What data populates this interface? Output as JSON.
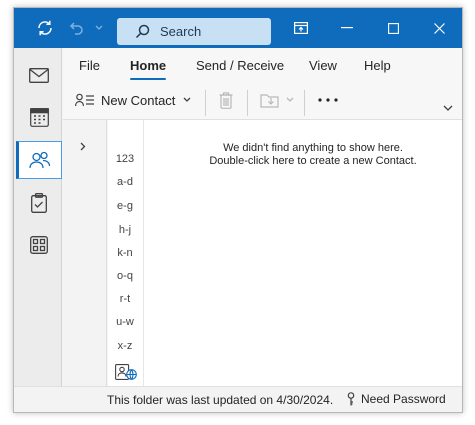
{
  "titlebar": {
    "search_placeholder": "Search"
  },
  "ribbon": {
    "tabs": [
      {
        "label": "File"
      },
      {
        "label": "Home"
      },
      {
        "label": "Send / Receive"
      },
      {
        "label": "View"
      },
      {
        "label": "Help"
      }
    ],
    "active_tab": "Home",
    "new_contact_label": "New Contact"
  },
  "appbar": {
    "apps": [
      "mail-icon",
      "calendar-icon",
      "people-icon",
      "tasks-icon",
      "apps-icon"
    ],
    "active": "people-icon"
  },
  "content": {
    "alphabet": [
      "123",
      "a-d",
      "e-g",
      "h-j",
      "k-n",
      "o-q",
      "r-t",
      "u-w",
      "x-z"
    ],
    "empty_line1": "We didn't find anything to show here.",
    "empty_line2": "Double-click here to create a new Contact."
  },
  "statusbar": {
    "text": "This folder was last updated on 4/30/2024.",
    "password": "Need Password"
  },
  "colors": {
    "accent": "#0f6cbd",
    "search_bg": "#c7e0f4"
  }
}
